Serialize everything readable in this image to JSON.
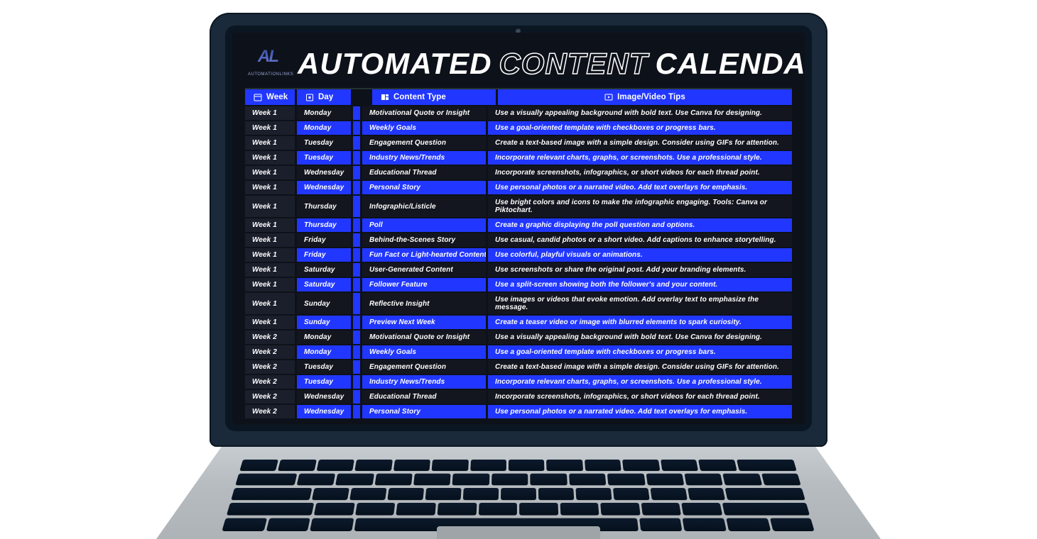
{
  "logo": {
    "mark": "AL",
    "sub": "AUTOMATIONLINKS"
  },
  "title": {
    "w1": "AUTOMATED",
    "w2": "CONTENT",
    "w3": "CALENDAR"
  },
  "columns": {
    "week": "Week",
    "day": "Day",
    "type": "Content Type",
    "tips": "Image/Video Tips"
  },
  "rows": [
    {
      "week": "Week 1",
      "day": "Monday",
      "type": "Motivational Quote or Insight",
      "tips": "Use a visually appealing background with bold text. Use Canva for designing."
    },
    {
      "week": "Week 1",
      "day": "Monday",
      "type": "Weekly Goals",
      "tips": "Use a goal-oriented template with checkboxes or progress bars."
    },
    {
      "week": "Week 1",
      "day": "Tuesday",
      "type": "Engagement Question",
      "tips": "Create a text-based image with a simple design. Consider using GIFs for attention."
    },
    {
      "week": "Week 1",
      "day": "Tuesday",
      "type": "Industry News/Trends",
      "tips": "Incorporate relevant charts, graphs, or screenshots. Use a professional style."
    },
    {
      "week": "Week 1",
      "day": "Wednesday",
      "type": "Educational Thread",
      "tips": "Incorporate screenshots, infographics, or short videos for each thread point."
    },
    {
      "week": "Week 1",
      "day": "Wednesday",
      "type": "Personal Story",
      "tips": "Use personal photos or a narrated video. Add text overlays for emphasis."
    },
    {
      "week": "Week 1",
      "day": "Thursday",
      "type": "Infographic/Listicle",
      "tips": "Use bright colors and icons to make the infographic engaging. Tools: Canva or Piktochart."
    },
    {
      "week": "Week 1",
      "day": "Thursday",
      "type": "Poll",
      "tips": "Create a graphic displaying the poll question and options."
    },
    {
      "week": "Week 1",
      "day": "Friday",
      "type": "Behind-the-Scenes Story",
      "tips": "Use casual, candid photos or a short video. Add captions to enhance storytelling."
    },
    {
      "week": "Week 1",
      "day": "Friday",
      "type": "Fun Fact or Light-hearted Content",
      "tips": "Use colorful, playful visuals or animations."
    },
    {
      "week": "Week 1",
      "day": "Saturday",
      "type": "User-Generated Content",
      "tips": "Use screenshots or share the original post. Add your branding elements."
    },
    {
      "week": "Week 1",
      "day": "Saturday",
      "type": "Follower Feature",
      "tips": "Use a split-screen showing both the follower's and your content."
    },
    {
      "week": "Week 1",
      "day": "Sunday",
      "type": "Reflective Insight",
      "tips": "Use images or videos that evoke emotion. Add overlay text to emphasize the message."
    },
    {
      "week": "Week 1",
      "day": "Sunday",
      "type": "Preview Next Week",
      "tips": "Create a teaser video or image with blurred elements to spark curiosity."
    },
    {
      "week": "Week 2",
      "day": "Monday",
      "type": "Motivational Quote or Insight",
      "tips": "Use a visually appealing background with bold text. Use Canva for designing."
    },
    {
      "week": "Week 2",
      "day": "Monday",
      "type": "Weekly Goals",
      "tips": "Use a goal-oriented template with checkboxes or progress bars."
    },
    {
      "week": "Week 2",
      "day": "Tuesday",
      "type": "Engagement Question",
      "tips": "Create a text-based image with a simple design. Consider using GIFs for attention."
    },
    {
      "week": "Week 2",
      "day": "Tuesday",
      "type": "Industry News/Trends",
      "tips": "Incorporate relevant charts, graphs, or screenshots. Use a professional style."
    },
    {
      "week": "Week 2",
      "day": "Wednesday",
      "type": "Educational Thread",
      "tips": "Incorporate screenshots, infographics, or short videos for each thread point."
    },
    {
      "week": "Week 2",
      "day": "Wednesday",
      "type": "Personal Story",
      "tips": "Use personal photos or a narrated video. Add text overlays for emphasis."
    }
  ]
}
